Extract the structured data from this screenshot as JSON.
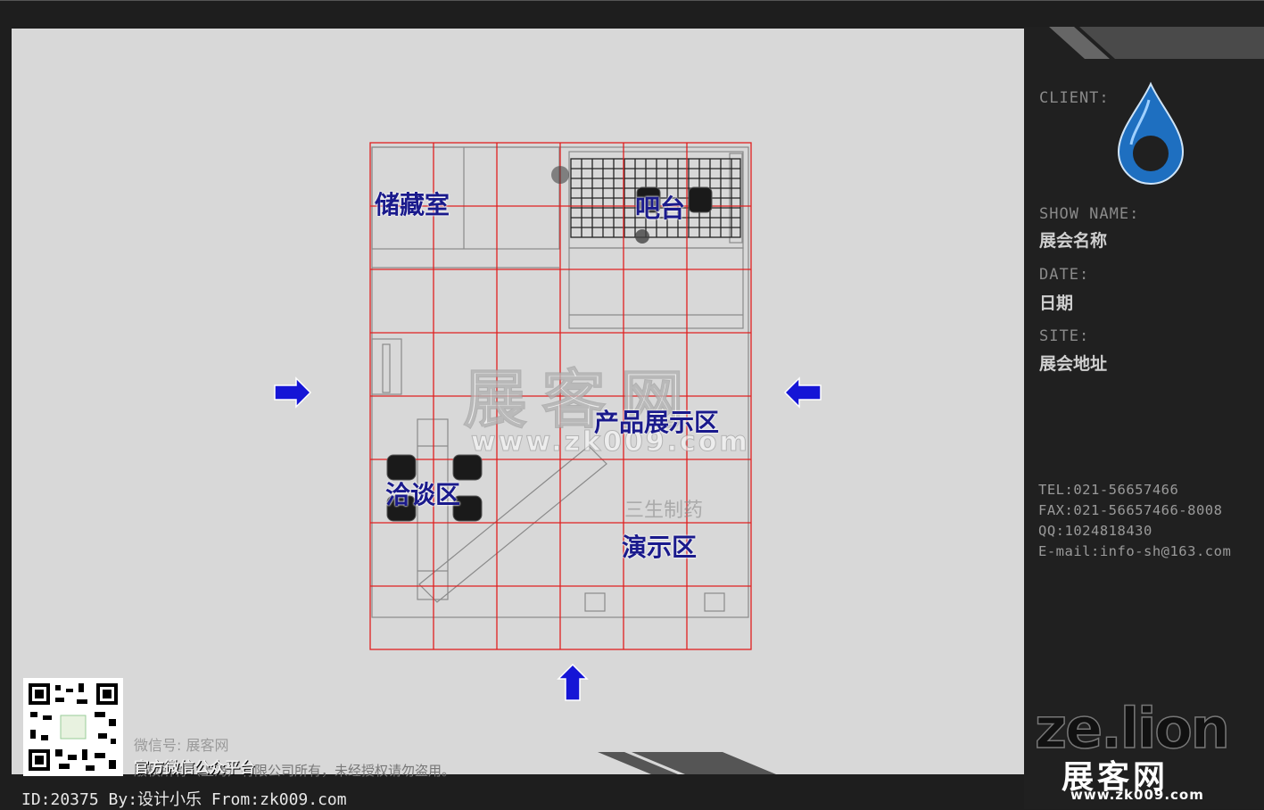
{
  "zones": {
    "storage": "储藏室",
    "bar": "吧台",
    "product_display": "产品展示区",
    "negotiation": "洽谈区",
    "demo": "演示区"
  },
  "side_panel": {
    "client_label": "CLIENT:",
    "show_name_label": "SHOW NAME:",
    "show_name_value": "展会名称",
    "date_label": "DATE:",
    "date_value": "日期",
    "site_label": "SITE:",
    "site_value": "展会地址",
    "contact": {
      "tel": "TEL:021-56657466",
      "fax": "FAX:021-56657466-8008",
      "qq": "QQ:1024818430",
      "email": "E-mail:info-sh@163.com"
    },
    "brand": "ze.lion",
    "brand_cn": "展客网",
    "brand_url": "www.zk009.com"
  },
  "watermarks": {
    "center": "展客网",
    "center_url": "www.zk009.com",
    "sansheng": "三生制药",
    "wechat": "微信号: 展客网",
    "official": "官方微信公众平台",
    "copyright": "版权所有（上海）有限公司所有，未经授权请勿盗用。"
  },
  "footer": {
    "id_line": "ID:20375 By:设计小乐 From:zk009.com"
  },
  "colors": {
    "grid": "#e02020",
    "arrow": "#1515d6",
    "label": "#1a1a8c",
    "logo_blue": "#1e6fc0"
  }
}
